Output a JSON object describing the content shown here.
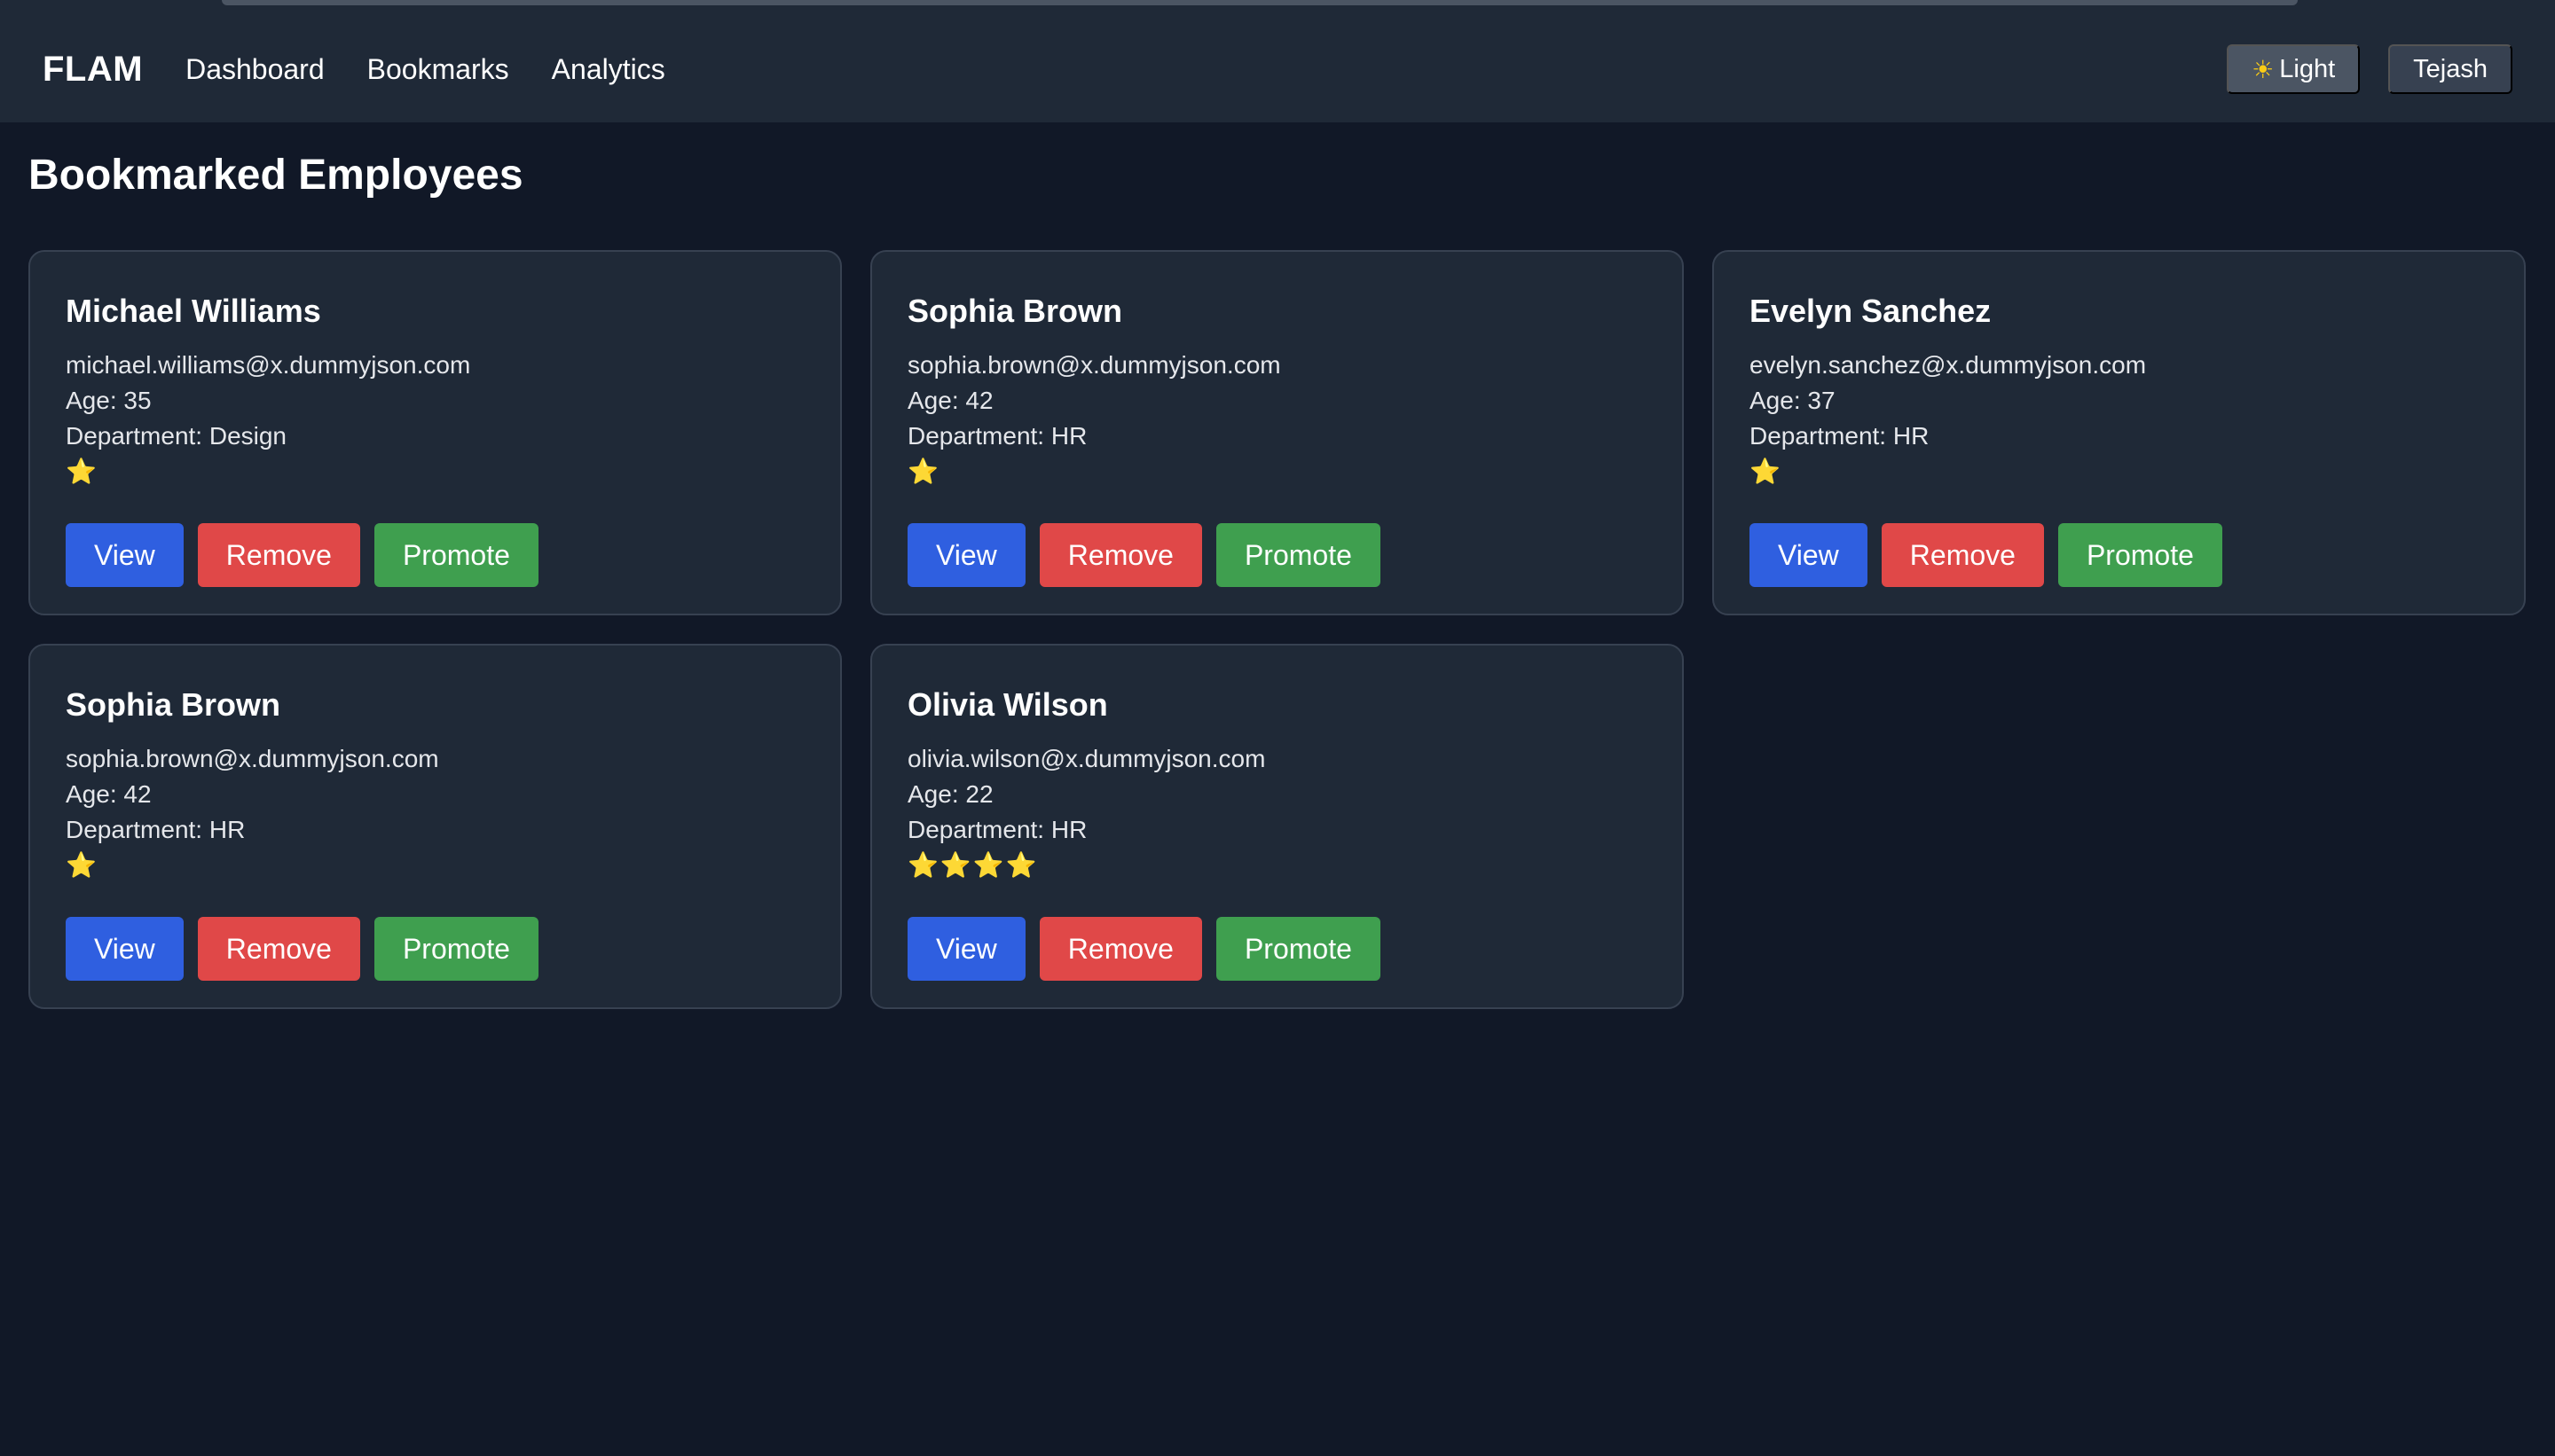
{
  "navbar": {
    "brand": "FLAM",
    "links": [
      "Dashboard",
      "Bookmarks",
      "Analytics"
    ],
    "theme_toggle": "Light",
    "theme_icon": "sun-icon",
    "user": "Tejash"
  },
  "page": {
    "title": "Bookmarked Employees"
  },
  "buttons": {
    "view": "View",
    "remove": "Remove",
    "promote": "Promote"
  },
  "employees": [
    {
      "name": "Michael Williams",
      "email": "michael.williams@x.dummyjson.com",
      "age": "Age: 35",
      "department": "Department: Design",
      "rating": 1,
      "stars": "⭐"
    },
    {
      "name": "Sophia Brown",
      "email": "sophia.brown@x.dummyjson.com",
      "age": "Age: 42",
      "department": "Department: HR",
      "rating": 1,
      "stars": "⭐"
    },
    {
      "name": "Evelyn Sanchez",
      "email": "evelyn.sanchez@x.dummyjson.com",
      "age": "Age: 37",
      "department": "Department: HR",
      "rating": 1,
      "stars": "⭐"
    },
    {
      "name": "Sophia Brown",
      "email": "sophia.brown@x.dummyjson.com",
      "age": "Age: 42",
      "department": "Department: HR",
      "rating": 1,
      "stars": "⭐"
    },
    {
      "name": "Olivia Wilson",
      "email": "olivia.wilson@x.dummyjson.com",
      "age": "Age: 22",
      "department": "Department: HR",
      "rating": 4,
      "stars": "⭐⭐⭐⭐"
    }
  ],
  "colors": {
    "background": "#111827",
    "surface": "#1f2937",
    "view_button": "#2f5fe0",
    "remove_button": "#e04848",
    "promote_button": "#3f9f4f",
    "star": "#facc15"
  }
}
